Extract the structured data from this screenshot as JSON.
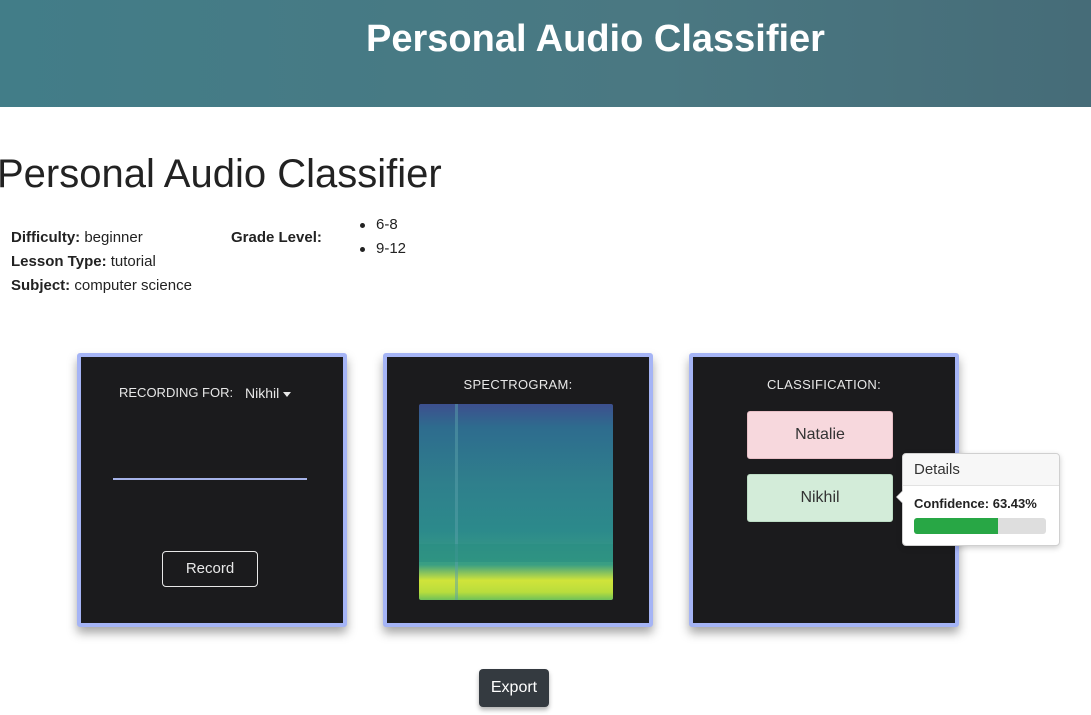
{
  "header": {
    "title": "Personal Audio Classifier"
  },
  "page": {
    "title": "Personal Audio Classifier"
  },
  "meta": {
    "difficulty_label": "Difficulty:",
    "difficulty_value": "beginner",
    "lesson_type_label": "Lesson Type:",
    "lesson_type_value": "tutorial",
    "subject_label": "Subject:",
    "subject_value": "computer science",
    "grade_label": "Grade Level:",
    "grades": [
      "6-8",
      "9-12"
    ]
  },
  "recording": {
    "label": "RECORDING FOR:",
    "selected_user": "Nikhil",
    "record_button": "Record"
  },
  "spectrogram": {
    "label": "SPECTROGRAM:"
  },
  "classification": {
    "label": "CLASSIFICATION:",
    "classes": [
      "Natalie",
      "Nikhil"
    ],
    "details": {
      "title": "Details",
      "confidence_text": "Confidence: 63.43%",
      "confidence_value": 0.6343,
      "fill_color": "#28a745"
    }
  },
  "export_button": "Export",
  "colors": {
    "banner": "#427d88",
    "card_border": "#a5b4f5",
    "natalie_bg": "#f7d8dd",
    "nikhil_bg": "#d3ecd9"
  }
}
